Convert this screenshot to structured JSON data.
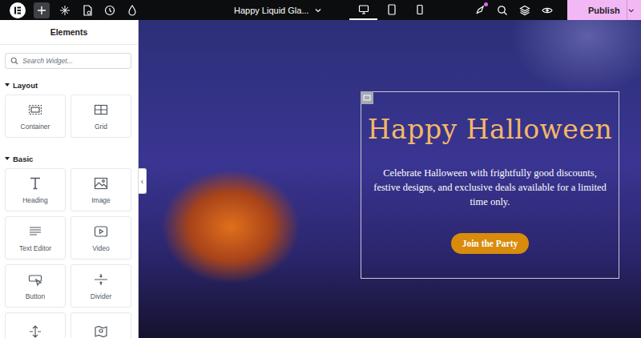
{
  "topbar": {
    "document_title": "Happy Liquid Gla...",
    "ai_notification": true,
    "devices": [
      {
        "selected": true
      },
      {
        "selected": false
      },
      {
        "selected": false
      }
    ],
    "publish": "Publish"
  },
  "panel": {
    "title": "Elements",
    "search": {
      "placeholder": "Search Widget..."
    },
    "collapse_handle": "‹",
    "sections": [
      {
        "title": "Layout",
        "expanded": true,
        "widgets": [
          {
            "label": "Container"
          },
          {
            "label": "Grid"
          }
        ]
      },
      {
        "title": "Basic",
        "expanded": true,
        "widgets": [
          {
            "label": "Heading"
          },
          {
            "label": "Image"
          },
          {
            "label": "Text Editor"
          },
          {
            "label": "Video"
          },
          {
            "label": "Button"
          },
          {
            "label": "Divider"
          },
          {
            "label": ""
          },
          {
            "label": ""
          }
        ]
      }
    ]
  },
  "canvas": {
    "container": {
      "selected": true,
      "heading": "Happy Halloween",
      "text": "Celebrate Halloween with frightfully good discounts, festive designs, and exclusive deals available for a limited time only.",
      "button": "Join the Party"
    }
  }
}
